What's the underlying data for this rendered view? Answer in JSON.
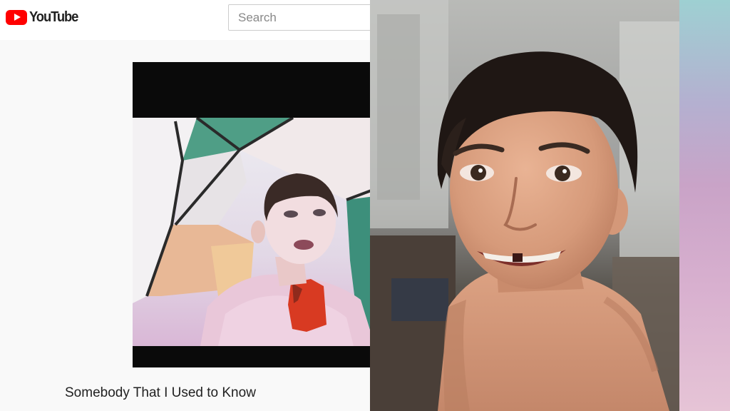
{
  "youtube": {
    "brand": "YouTube",
    "logo_icon": "youtube-play-icon",
    "search_placeholder": "Search",
    "video_title": "Somebody That I Used to Know",
    "accent": "#ff0000"
  },
  "side_strip": {
    "colors": [
      "#9ed0d2",
      "#c9a3c7",
      "#e6c4d6"
    ]
  }
}
